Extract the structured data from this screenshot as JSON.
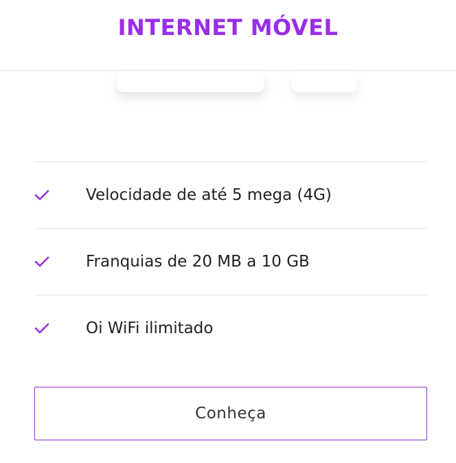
{
  "header": {
    "title": "INTERNET MÓVEL"
  },
  "features": [
    {
      "icon": "check-icon",
      "label": "Velocidade de até 5 mega (4G)"
    },
    {
      "icon": "check-icon",
      "label": "Franquias de 20 MB a 10 GB"
    },
    {
      "icon": "check-icon",
      "label": "Oi WiFi ilimitado"
    }
  ],
  "cta": {
    "label": "Conheça"
  },
  "colors": {
    "accent": "#9a2ee6",
    "text": "#222222",
    "divider": "#e3e3e3"
  }
}
